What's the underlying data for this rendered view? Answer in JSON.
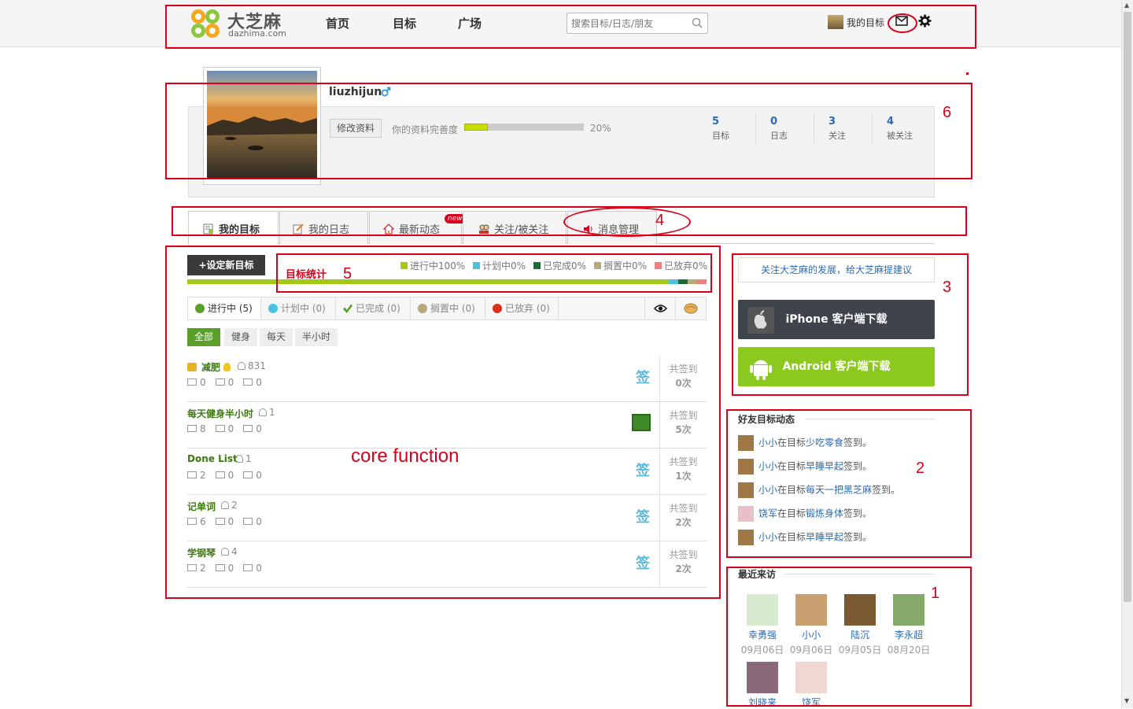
{
  "header": {
    "logo_text": "大芝麻",
    "logo_sub": "dazhima.com",
    "nav": [
      "首页",
      "目标",
      "广场"
    ],
    "search_placeholder": "搜索目标/日志/朋友",
    "my_goal": "我的目标"
  },
  "profile": {
    "username": "liuzhijun",
    "edit_label": "修改资料",
    "complete_label": "你的资料完善度",
    "complete_pct": "20%",
    "complete_value": 0.2,
    "stats": [
      {
        "num": "5",
        "label": "目标"
      },
      {
        "num": "0",
        "label": "日志"
      },
      {
        "num": "3",
        "label": "关注"
      },
      {
        "num": "4",
        "label": "被关注"
      }
    ]
  },
  "tabs": [
    {
      "label": "我的目标",
      "icon": "goal-icon"
    },
    {
      "label": "我的日志",
      "icon": "diary-icon"
    },
    {
      "label": "最新动态",
      "icon": "home-icon"
    },
    {
      "label": "关注/被关注",
      "icon": "people-icon"
    },
    {
      "label": "消息管理",
      "icon": "speaker-icon"
    }
  ],
  "new_badge": "new",
  "goals": {
    "new_goal_label": "+设定新目标",
    "stats_title": "目标统计",
    "legend": [
      {
        "label": "进行中100%",
        "color": "#a3c816"
      },
      {
        "label": "计划中0%",
        "color": "#4cc0e0"
      },
      {
        "label": "已完成0%",
        "color": "#1e6b3a"
      },
      {
        "label": "搁置中0%",
        "color": "#b8a97a"
      },
      {
        "label": "已放弃0%",
        "color": "#f08080"
      }
    ],
    "status_tabs": [
      "进行中 (5)",
      "计划中 (0)",
      "已完成 (0)",
      "搁置中 (0)",
      "已放弃 (0)"
    ],
    "filters": [
      "全部",
      "健身",
      "每天",
      "半小时"
    ],
    "sign_total_label": "共签到",
    "sign_label": "签",
    "list": [
      {
        "name": "减肥",
        "people": "831",
        "logs": "0",
        "views": "0",
        "cheers": "0",
        "count": "0次",
        "signed": false
      },
      {
        "name": "每天健身半小时",
        "people": "1",
        "logs": "8",
        "views": "0",
        "cheers": "0",
        "count": "5次",
        "signed": true
      },
      {
        "name": "Done List",
        "people": "1",
        "logs": "2",
        "views": "0",
        "cheers": "0",
        "count": "1次",
        "signed": false
      },
      {
        "name": "记单词",
        "people": "2",
        "logs": "6",
        "views": "0",
        "cheers": "0",
        "count": "2次",
        "signed": false
      },
      {
        "name": "学钢琴",
        "people": "4",
        "logs": "2",
        "views": "0",
        "cheers": "0",
        "count": "2次",
        "signed": false
      }
    ]
  },
  "sidebar": {
    "suggest": "关注大芝麻的发展，给大芝麻提建议",
    "iphone_dl": "iPhone 客户端下载",
    "android_dl": "Android 客户端下载",
    "feed_title": "好友目标动态",
    "feed": [
      {
        "user": "小小",
        "mid": "在目标",
        "goal": "少吃零食",
        "end": "签到。"
      },
      {
        "user": "小小",
        "mid": "在目标",
        "goal": "早睡早起",
        "end": "签到。"
      },
      {
        "user": "小小",
        "mid": "在目标",
        "goal": "每天一把黑芝麻",
        "end": "签到。"
      },
      {
        "user": "饶军",
        "mid": "在目标",
        "goal": "锻炼身体",
        "end": "签到。"
      },
      {
        "user": "小小",
        "mid": "在目标",
        "goal": "早睡早起",
        "end": "签到。"
      }
    ],
    "visitors_title": "最近来访",
    "visitors": [
      {
        "name": "幸勇强",
        "date": "09月06日"
      },
      {
        "name": "小小",
        "date": "09月06日"
      },
      {
        "name": "陆沉",
        "date": "09月05日"
      },
      {
        "name": "李永超",
        "date": "08月20日"
      },
      {
        "name": "刘晓来",
        "date": ""
      },
      {
        "name": "饶军",
        "date": ""
      }
    ]
  },
  "annotations": {
    "n1": "1",
    "n2": "2",
    "n3": "3",
    "n4": "4",
    "n5": "5",
    "n6": "6",
    "core": "core  function",
    "annotation_color": "#d9001b"
  }
}
